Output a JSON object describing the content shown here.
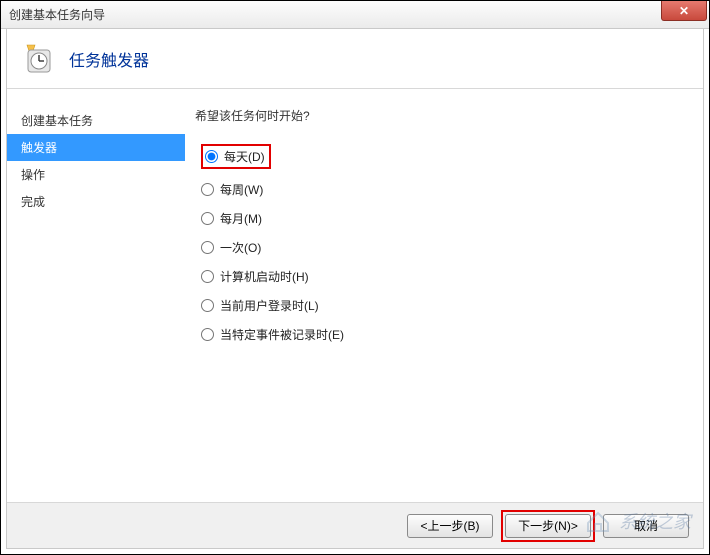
{
  "window": {
    "title": "创建基本任务向导",
    "close_glyph": "✕"
  },
  "header": {
    "page_title": "任务触发器"
  },
  "sidebar": {
    "items": [
      {
        "label": "创建基本任务",
        "selected": false
      },
      {
        "label": "触发器",
        "selected": true
      },
      {
        "label": "操作",
        "selected": false
      },
      {
        "label": "完成",
        "selected": false
      }
    ]
  },
  "main": {
    "prompt": "希望该任务何时开始?",
    "options": [
      {
        "label": "每天(D)",
        "checked": true,
        "highlighted": true
      },
      {
        "label": "每周(W)",
        "checked": false,
        "highlighted": false
      },
      {
        "label": "每月(M)",
        "checked": false,
        "highlighted": false
      },
      {
        "label": "一次(O)",
        "checked": false,
        "highlighted": false
      },
      {
        "label": "计算机启动时(H)",
        "checked": false,
        "highlighted": false
      },
      {
        "label": "当前用户登录时(L)",
        "checked": false,
        "highlighted": false
      },
      {
        "label": "当特定事件被记录时(E)",
        "checked": false,
        "highlighted": false
      }
    ]
  },
  "footer": {
    "back_label": "<上一步(B)",
    "next_label": "下一步(N)>",
    "cancel_label": "取消",
    "next_highlighted": true
  },
  "watermark": {
    "text": "系统之家"
  }
}
